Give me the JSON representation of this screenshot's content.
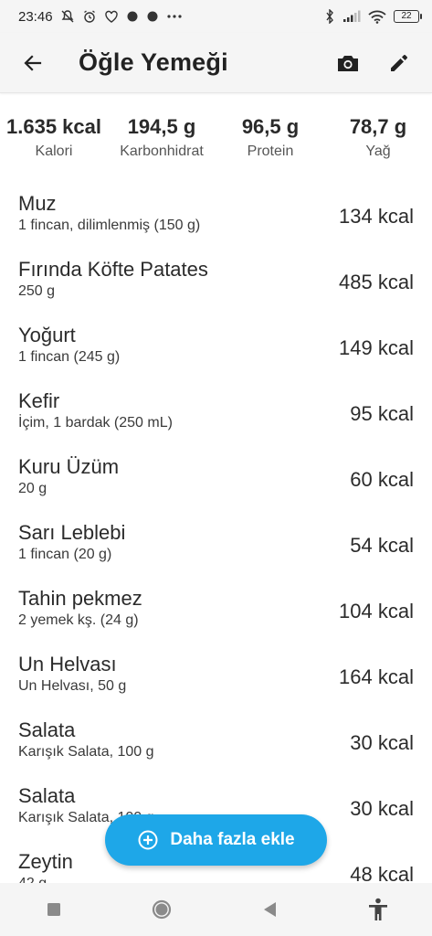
{
  "status_bar": {
    "time": "23:46",
    "left_glyphs": "½ ⏰ ♡ • • ···",
    "battery": "22"
  },
  "app_bar": {
    "title": "Öğle Yemeği"
  },
  "summary": [
    {
      "value": "1.635 kcal",
      "label": "Kalori"
    },
    {
      "value": "194,5 g",
      "label": "Karbonhidrat"
    },
    {
      "value": "96,5 g",
      "label": "Protein"
    },
    {
      "value": "78,7 g",
      "label": "Yağ"
    }
  ],
  "foods": [
    {
      "name": "Muz",
      "desc": "1 fincan, dilimlenmiş (150 g)",
      "kcal": "134 kcal"
    },
    {
      "name": "Fırında Köfte Patates",
      "desc": "250 g",
      "kcal": "485 kcal"
    },
    {
      "name": "Yoğurt",
      "desc": "1 fincan (245 g)",
      "kcal": "149 kcal"
    },
    {
      "name": "Kefir",
      "desc": "İçim, 1 bardak (250 mL)",
      "kcal": "95 kcal"
    },
    {
      "name": "Kuru Üzüm",
      "desc": "20 g",
      "kcal": "60 kcal"
    },
    {
      "name": "Sarı Leblebi",
      "desc": "1 fincan (20 g)",
      "kcal": "54 kcal"
    },
    {
      "name": "Tahin pekmez",
      "desc": "2 yemek kş.  (24 g)",
      "kcal": "104 kcal"
    },
    {
      "name": "Un Helvası",
      "desc": "Un Helvası, 50 g",
      "kcal": "164 kcal"
    },
    {
      "name": "Salata",
      "desc": "Karışık Salata, 100 g",
      "kcal": "30 kcal"
    },
    {
      "name": "Salata",
      "desc": "Karışık Salata, 100 g",
      "kcal": "30 kcal"
    },
    {
      "name": "Zeytin",
      "desc": "42 g",
      "kcal": "48 kcal"
    }
  ],
  "fab": {
    "label": "Daha fazla ekle"
  },
  "colors": {
    "accent": "#1ea7e8",
    "bar_background": "#f5f5f5"
  }
}
